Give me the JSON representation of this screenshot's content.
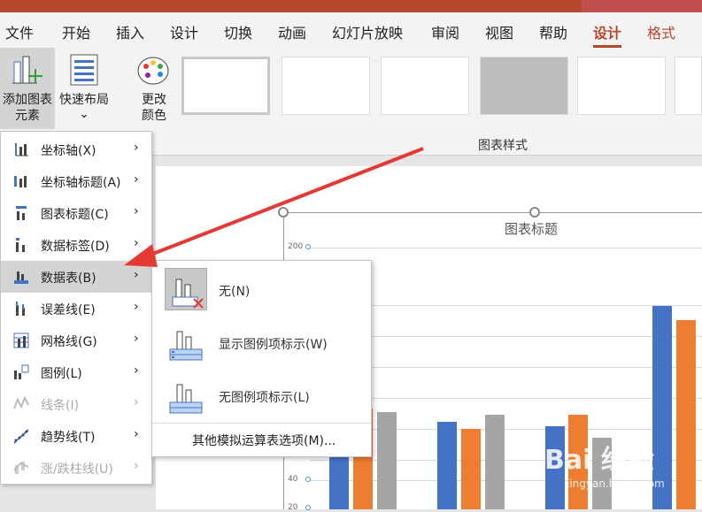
{
  "tabs": [
    "文件",
    "开始",
    "插入",
    "设计",
    "切换",
    "动画",
    "幻灯片放映",
    "审阅",
    "视图",
    "帮助",
    "设计",
    "格式"
  ],
  "ribbon": {
    "add_element": [
      "添加图表",
      "元素"
    ],
    "quick_layout": "快速布局",
    "change_color": [
      "更改",
      "颜色"
    ],
    "group_label": "图表样式"
  },
  "menu": [
    {
      "label": "坐标轴(X)",
      "icon": "axis-icon",
      "disabled": false
    },
    {
      "label": "坐标轴标题(A)",
      "icon": "axis-title-icon",
      "disabled": false
    },
    {
      "label": "图表标题(C)",
      "icon": "chart-title-icon",
      "disabled": false
    },
    {
      "label": "数据标签(D)",
      "icon": "data-label-icon",
      "disabled": false
    },
    {
      "label": "数据表(B)",
      "icon": "data-table-icon",
      "disabled": false,
      "hover": true
    },
    {
      "label": "误差线(E)",
      "icon": "error-bar-icon",
      "disabled": false
    },
    {
      "label": "网格线(G)",
      "icon": "gridlines-icon",
      "disabled": false
    },
    {
      "label": "图例(L)",
      "icon": "legend-icon",
      "disabled": false
    },
    {
      "label": "线条(I)",
      "icon": "lines-icon",
      "disabled": true
    },
    {
      "label": "趋势线(T)",
      "icon": "trendline-icon",
      "disabled": false
    },
    {
      "label": "涨/跌柱线(U)",
      "icon": "updown-bars-icon",
      "disabled": true
    }
  ],
  "submenu": {
    "items": [
      "无(N)",
      "显示图例项标示(W)",
      "无图例项标示(L)"
    ],
    "more": "其他模拟运算表选项(M)..."
  },
  "chart": {
    "title": "图表标题",
    "yticks": [
      "200",
      "40",
      "20"
    ]
  },
  "watermark": {
    "main": "Bai 经验",
    "sub": "jingyan.baidu.com"
  },
  "colors": {
    "accent": "#b7472a",
    "blue": "#4472c4",
    "orange": "#ed7d31",
    "gray": "#a5a5a5"
  }
}
